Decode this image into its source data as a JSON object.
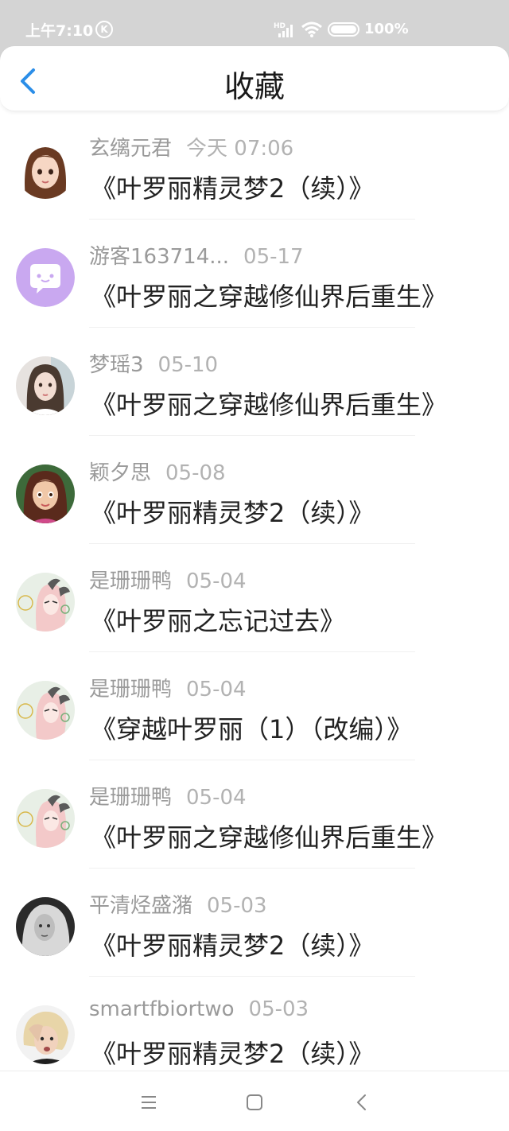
{
  "status_bar": {
    "time": "上午7:10",
    "k_badge": "K",
    "battery": "100%"
  },
  "header": {
    "title": "收藏"
  },
  "items": [
    {
      "user": "玄缡元君",
      "date": "今天 07:06",
      "title": "《叶罗丽精灵梦2（续）》",
      "avatar": "cartoon-girl-avatar"
    },
    {
      "user": "游客163714...",
      "date": "05-17",
      "title": "《叶罗丽之穿越修仙界后重生》",
      "avatar": "chat-bubble-avatar"
    },
    {
      "user": "梦瑶3",
      "date": "05-10",
      "title": "《叶罗丽之穿越修仙界后重生》",
      "avatar": "photo-girl-avatar"
    },
    {
      "user": "颖夕思",
      "date": "05-08",
      "title": "《叶罗丽精灵梦2（续）》",
      "avatar": "doll-avatar"
    },
    {
      "user": "是珊珊鸭",
      "date": "05-04",
      "title": "《叶罗丽之忘记过去》",
      "avatar": "anime-sketch-avatar"
    },
    {
      "user": "是珊珊鸭",
      "date": "05-04",
      "title": "《穿越叶罗丽（1）（改编）》",
      "avatar": "anime-sketch-avatar"
    },
    {
      "user": "是珊珊鸭",
      "date": "05-04",
      "title": "《叶罗丽之穿越修仙界后重生》",
      "avatar": "anime-sketch-avatar"
    },
    {
      "user": "平清烃盛潴",
      "date": "05-03",
      "title": "《叶罗丽精灵梦2（续）》",
      "avatar": "bw-photo-avatar"
    },
    {
      "user": "smartfbiortwo",
      "date": "05-03",
      "title": "《叶罗丽精灵梦2（续）》",
      "avatar": "blonde-photo-avatar"
    }
  ],
  "colors": {
    "accent": "#2b8ee8",
    "status_bar_bg": "#d4d4d4",
    "chat_avatar_bg": "#c9a8f0"
  }
}
